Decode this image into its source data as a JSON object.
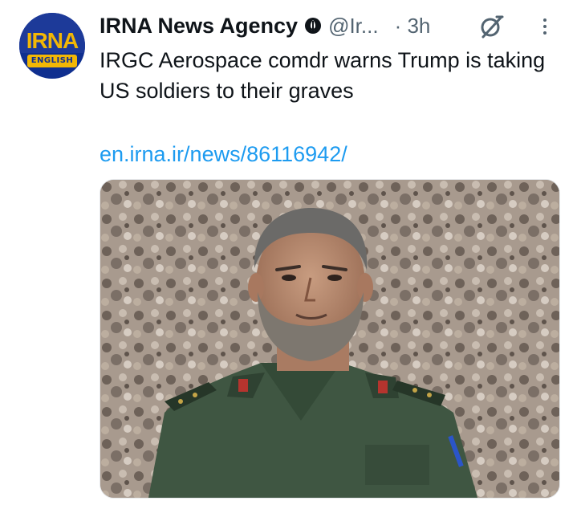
{
  "post": {
    "author_name": "IRNA News Agency",
    "handle": "@Ir...",
    "time": "· 3h",
    "text": "IRGC Aerospace comdr warns Trump is taking US soldiers to their graves",
    "link": "en.irna.ir/news/86116942/"
  },
  "avatar": {
    "logo_text": "IRNA",
    "logo_sub": "ENGLISH"
  },
  "icons": {
    "affiliation": "government-emblem-icon",
    "grok": "grok-icon",
    "more": "more-options-icon"
  },
  "colors": {
    "link": "#1d9bf0",
    "muted": "#536471",
    "text": "#0f1419",
    "logo_blue": "#1d3a99",
    "logo_yellow": "#f2b705"
  }
}
